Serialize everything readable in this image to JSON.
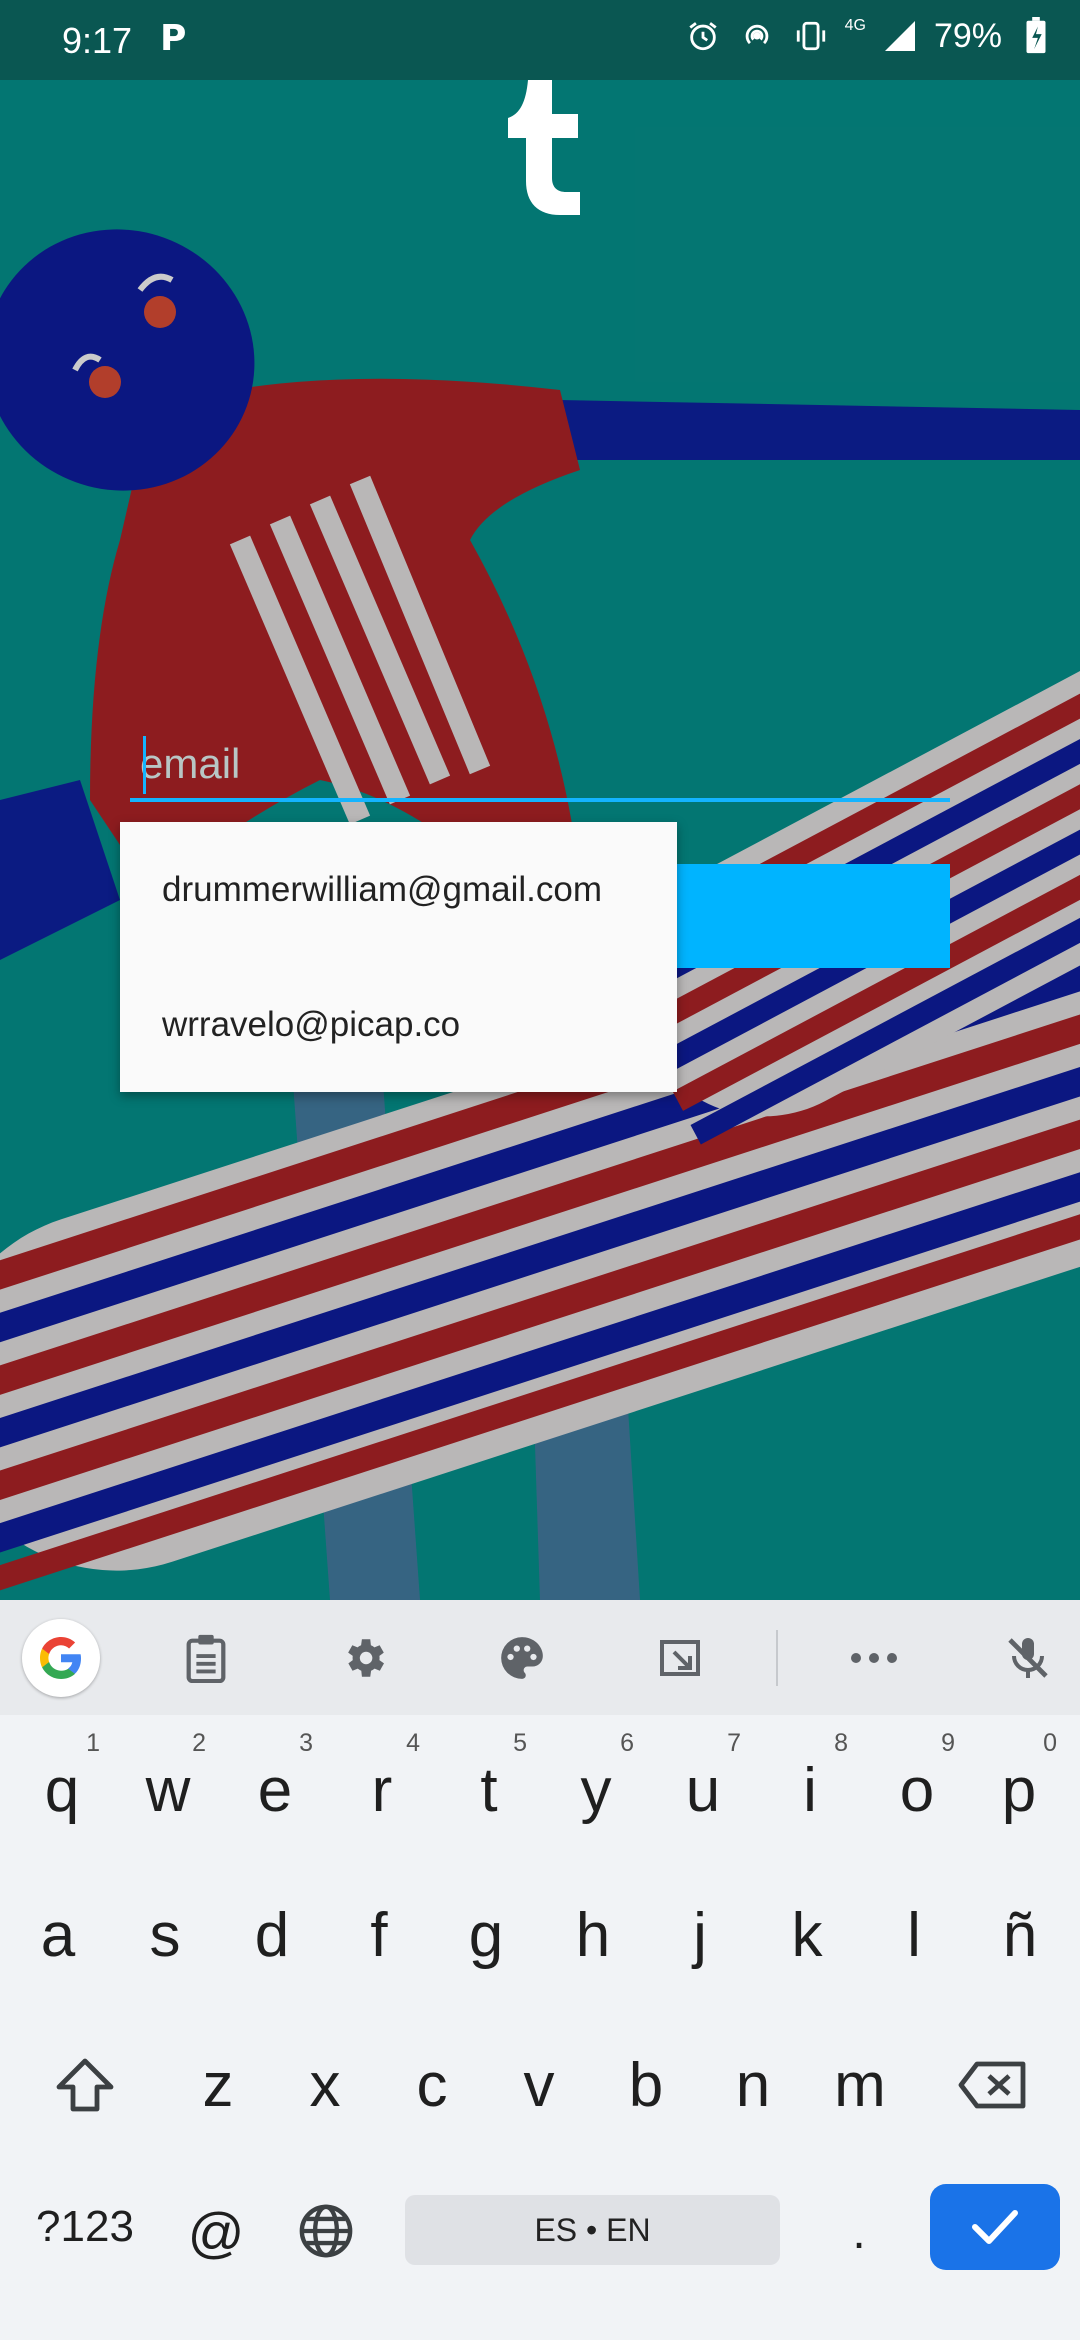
{
  "status_bar": {
    "time": "9:17",
    "battery": "79%",
    "network": "4G",
    "icons": [
      "parking-app-icon",
      "alarm-icon",
      "hotspot-icon",
      "vibrate-icon",
      "signal-icon",
      "battery-charging-icon"
    ]
  },
  "login": {
    "logo": "tumblr-logo",
    "email_placeholder": "email",
    "email_value": ""
  },
  "autocomplete": {
    "suggestions": [
      "drummerwilliam@gmail.com",
      "wrravelo@picap.co"
    ]
  },
  "keyboard": {
    "toolbar": [
      "google-icon",
      "clipboard-icon",
      "settings-icon",
      "palette-icon",
      "resize-icon",
      "more-icon",
      "mic-off-icon"
    ],
    "row1": [
      {
        "key": "q",
        "hint": "1"
      },
      {
        "key": "w",
        "hint": "2"
      },
      {
        "key": "e",
        "hint": "3"
      },
      {
        "key": "r",
        "hint": "4"
      },
      {
        "key": "t",
        "hint": "5"
      },
      {
        "key": "y",
        "hint": "6"
      },
      {
        "key": "u",
        "hint": "7"
      },
      {
        "key": "i",
        "hint": "8"
      },
      {
        "key": "o",
        "hint": "9"
      },
      {
        "key": "p",
        "hint": "0"
      }
    ],
    "row2": [
      "a",
      "s",
      "d",
      "f",
      "g",
      "h",
      "j",
      "k",
      "l",
      "ñ"
    ],
    "row3": [
      "z",
      "x",
      "c",
      "v",
      "b",
      "n",
      "m"
    ],
    "symbols_key": "?123",
    "at_key": "@",
    "space_label": "ES • EN",
    "period_key": ".",
    "accent_color": "#1a73e8"
  }
}
